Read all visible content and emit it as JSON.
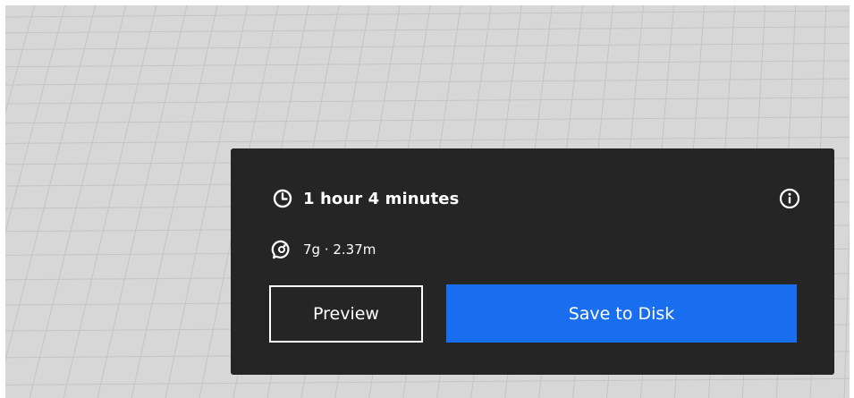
{
  "viewport": {
    "background_color": "#d7d7d7",
    "grid_color": "#c4c4c4"
  },
  "print_panel": {
    "background_color": "#252525",
    "print_time": "1 hour 4 minutes",
    "material_usage": "7g · 2.37m",
    "icons": {
      "time": "clock-icon",
      "material": "filament-spool-icon",
      "info": "info-icon"
    },
    "preview_label": "Preview",
    "save_label": "Save to Disk",
    "accent_color": "#196ef0"
  }
}
